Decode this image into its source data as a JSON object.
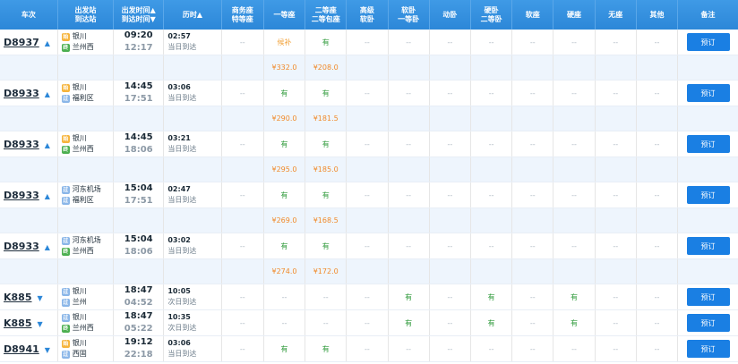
{
  "header": {
    "train": "车次",
    "stations": "出发站\n到达站",
    "times": "出发时间▲\n到达时间▼",
    "duration": "历时▲",
    "business": "商务座\n特等座",
    "first": "一等座",
    "second": "二等座\n二等包座",
    "high_soft": "高级\n软卧",
    "soft_first": "软卧\n一等卧",
    "dongwo": "动卧",
    "hard_second": "硬卧\n二等卧",
    "soft_seat": "软座",
    "hard_seat": "硬座",
    "no_seat": "无座",
    "other": "其他",
    "remark": "备注"
  },
  "book_label": "预订",
  "rows": [
    {
      "train": "D8937",
      "from": "银川",
      "from_type": "始",
      "to": "兰州西",
      "to_type": "终",
      "dep": "09:20",
      "arr": "12:17",
      "dur": "02:57",
      "dur_note": "当日到达",
      "seats": [
        "--",
        "候补",
        "有",
        "--",
        "--",
        "--",
        "--",
        "--",
        "--",
        "--",
        "--"
      ],
      "prices": [
        "",
        "¥332.0",
        "¥208.0",
        "",
        "",
        "",
        "",
        "",
        "",
        "",
        ""
      ]
    },
    {
      "train": "D8933",
      "from": "银川",
      "from_type": "始",
      "to": "福利区",
      "to_type": "过",
      "dep": "14:45",
      "arr": "17:51",
      "dur": "03:06",
      "dur_note": "当日到达",
      "seats": [
        "--",
        "有",
        "有",
        "--",
        "--",
        "--",
        "--",
        "--",
        "--",
        "--",
        "--"
      ],
      "prices": [
        "",
        "¥290.0",
        "¥181.5",
        "",
        "",
        "",
        "",
        "",
        "",
        "",
        ""
      ]
    },
    {
      "train": "D8933",
      "from": "银川",
      "from_type": "始",
      "to": "兰州西",
      "to_type": "终",
      "dep": "14:45",
      "arr": "18:06",
      "dur": "03:21",
      "dur_note": "当日到达",
      "seats": [
        "--",
        "有",
        "有",
        "--",
        "--",
        "--",
        "--",
        "--",
        "--",
        "--",
        "--"
      ],
      "prices": [
        "",
        "¥295.0",
        "¥185.0",
        "",
        "",
        "",
        "",
        "",
        "",
        "",
        ""
      ]
    },
    {
      "train": "D8933",
      "from": "河东机场",
      "from_type": "过",
      "to": "福利区",
      "to_type": "过",
      "dep": "15:04",
      "arr": "17:51",
      "dur": "02:47",
      "dur_note": "当日到达",
      "seats": [
        "--",
        "有",
        "有",
        "--",
        "--",
        "--",
        "--",
        "--",
        "--",
        "--",
        "--"
      ],
      "prices": [
        "",
        "¥269.0",
        "¥168.5",
        "",
        "",
        "",
        "",
        "",
        "",
        "",
        ""
      ]
    },
    {
      "train": "D8933",
      "from": "河东机场",
      "from_type": "过",
      "to": "兰州西",
      "to_type": "终",
      "dep": "15:04",
      "arr": "18:06",
      "dur": "03:02",
      "dur_note": "当日到达",
      "seats": [
        "--",
        "有",
        "有",
        "--",
        "--",
        "--",
        "--",
        "--",
        "--",
        "--",
        "--"
      ],
      "prices": [
        "",
        "¥274.0",
        "¥172.0",
        "",
        "",
        "",
        "",
        "",
        "",
        "",
        ""
      ]
    }
  ],
  "rows_simple": [
    {
      "train": "K885",
      "from": "银川",
      "from_type": "过",
      "to": "兰州",
      "to_type": "过",
      "dep": "18:47",
      "arr": "04:52",
      "dur": "10:05",
      "dur_note": "次日到达",
      "seats": [
        "--",
        "--",
        "--",
        "--",
        "有",
        "--",
        "有",
        "--",
        "有",
        "--",
        "--"
      ]
    },
    {
      "train": "K885",
      "from": "银川",
      "from_type": "过",
      "to": "兰州西",
      "to_type": "终",
      "dep": "18:47",
      "arr": "05:22",
      "dur": "10:35",
      "dur_note": "次日到达",
      "seats": [
        "--",
        "--",
        "--",
        "--",
        "有",
        "--",
        "有",
        "--",
        "有",
        "--",
        "--"
      ]
    },
    {
      "train": "D8941",
      "from": "银川",
      "from_type": "始",
      "to": "西固",
      "to_type": "过",
      "dep": "19:12",
      "arr": "22:18",
      "dur": "03:06",
      "dur_note": "当日到达",
      "seats": [
        "--",
        "有",
        "有",
        "--",
        "--",
        "--",
        "--",
        "--",
        "--",
        "--",
        "--"
      ]
    }
  ]
}
